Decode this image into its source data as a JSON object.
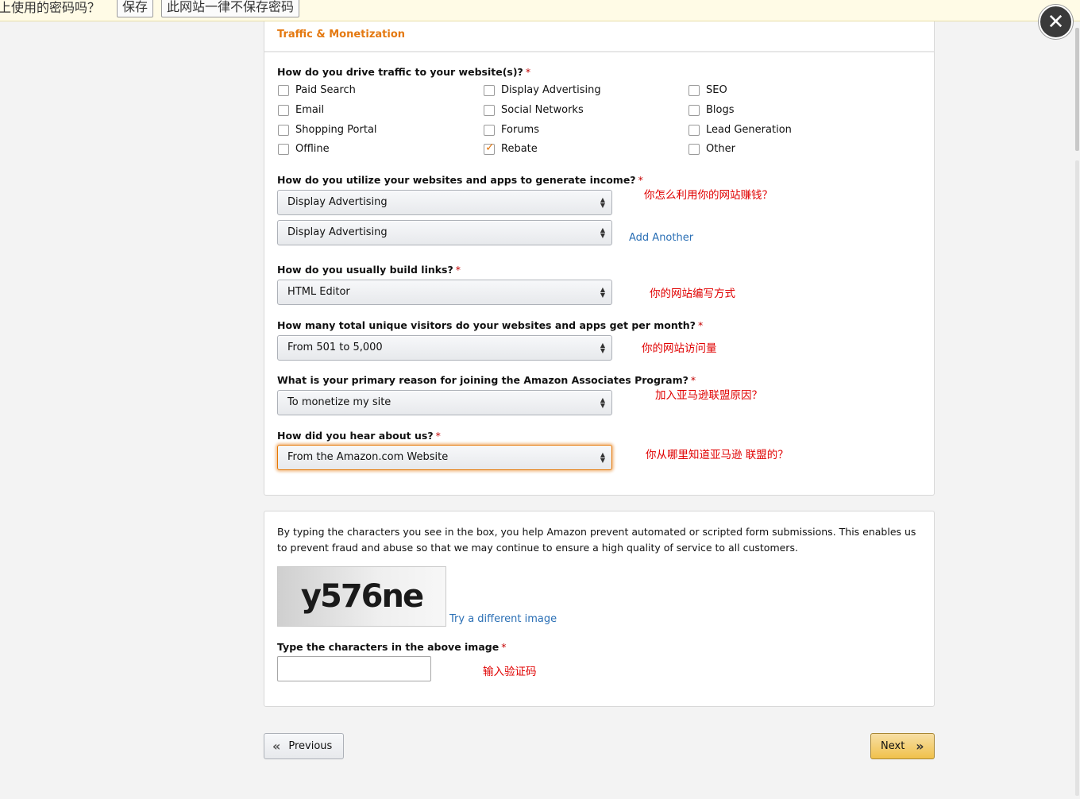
{
  "password_bar": {
    "message": "上使用的密码吗？",
    "save_label": "保存",
    "never_label": "此网站一律不保存密码"
  },
  "section": {
    "title": "Traffic & Monetization"
  },
  "traffic": {
    "question": "How do you drive traffic to your website(s)?",
    "required_mark": "*",
    "options": [
      {
        "label": "Paid Search",
        "checked": false
      },
      {
        "label": "Display Advertising",
        "checked": false
      },
      {
        "label": "SEO",
        "checked": false
      },
      {
        "label": "Email",
        "checked": false
      },
      {
        "label": "Social Networks",
        "checked": false
      },
      {
        "label": "Blogs",
        "checked": false
      },
      {
        "label": "Shopping Portal",
        "checked": false
      },
      {
        "label": "Forums",
        "checked": false
      },
      {
        "label": "Lead Generation",
        "checked": false
      },
      {
        "label": "Offline",
        "checked": false
      },
      {
        "label": "Rebate",
        "checked": true
      },
      {
        "label": "Other",
        "checked": false
      }
    ]
  },
  "income": {
    "question": "How do you utilize your websites and apps to generate income?",
    "select1": "Display Advertising",
    "select2": "Display Advertising",
    "add_another": "Add Another",
    "note": "你怎么利用你的网站赚钱？"
  },
  "links": {
    "question": "How do you usually build links?",
    "value": "HTML Editor",
    "note": "你的网站编写方式"
  },
  "visitors": {
    "question": "How many total unique visitors do your websites and apps get per month?",
    "value": "From 501 to 5,000",
    "note": "你的网站访问量"
  },
  "reason": {
    "question": "What is your primary reason for joining the Amazon Associates Program?",
    "value": "To monetize my site",
    "note": "加入亚马逊联盟原因？"
  },
  "hear": {
    "question": "How did you hear about us?",
    "value": "From the Amazon.com Website",
    "note": "你从哪里知道亚马逊 联盟的？"
  },
  "captcha": {
    "description": "By typing the characters you see in the box, you help Amazon prevent automated or scripted form submissions. This enables us to prevent fraud and abuse so that we may continue to ensure a high quality of service to all customers.",
    "image_text": "y576ne",
    "try_different": "Try a different image",
    "input_label": "Type the characters in the above image",
    "input_value": "",
    "note": "输入验证码"
  },
  "nav": {
    "previous_label": "Previous",
    "next_label": "Next"
  },
  "colors": {
    "accent_orange": "#e47911",
    "note_red": "#e00000",
    "link_blue": "#2a6fb5",
    "next_button": "#f0c14b"
  }
}
